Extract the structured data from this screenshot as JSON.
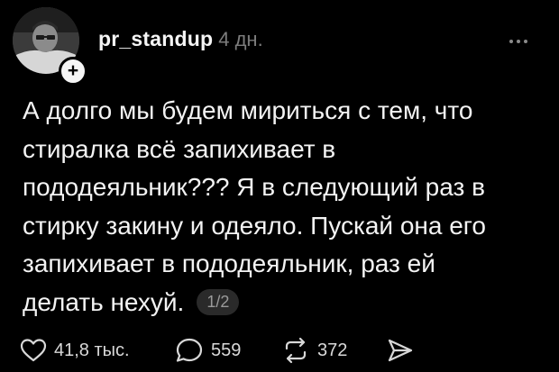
{
  "post": {
    "username": "pr_standup",
    "timestamp": "4 дн.",
    "text_lines": [
      "А долго мы будем мириться с тем, что",
      "стиралка всё запихивает в",
      "пододеяльник??? Я в следующий раз в",
      "стирку закину и одеяло. Пускай она его",
      "запихивает в пододеяльник, раз ей",
      "делать нехуй."
    ],
    "page_indicator": "1/2"
  },
  "actions": {
    "likes": "41,8 тыс.",
    "comments": "559",
    "reposts": "372"
  },
  "icons": {
    "follow": "plus-icon",
    "more": "more-horizontal-icon",
    "like": "heart-icon",
    "comment": "comment-icon",
    "repost": "repost-icon",
    "share": "send-icon"
  },
  "colors": {
    "background": "#000000",
    "text": "#f3f3f3",
    "muted": "#7c7c7c",
    "badge_bg": "#2a2a2a"
  }
}
